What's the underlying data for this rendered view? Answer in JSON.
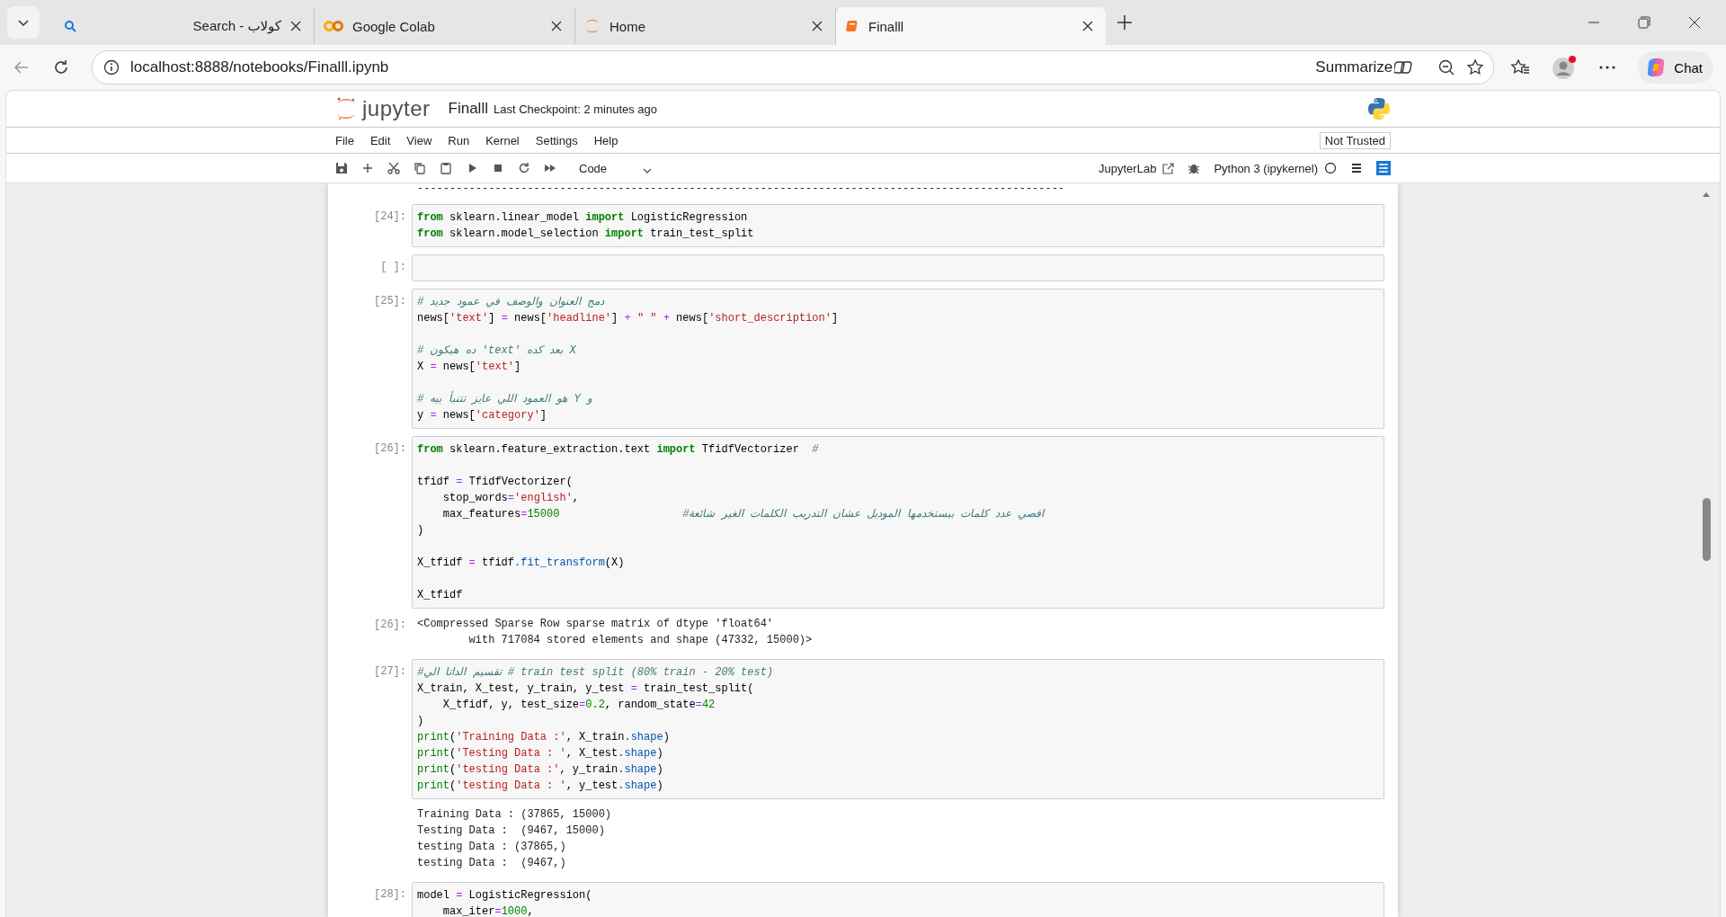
{
  "browser": {
    "tabs": [
      {
        "kind": "search",
        "title": "Search - كولاب",
        "selected": false
      },
      {
        "kind": "colab",
        "title": "Google Colab",
        "selected": false
      },
      {
        "kind": "jupyter",
        "title": "Home",
        "selected": false
      },
      {
        "kind": "notebook",
        "title": "Finalll",
        "selected": true
      }
    ],
    "url": "localhost:8888/notebooks/Finalll.ipynb",
    "summarize": "Summarize",
    "chat": "Chat"
  },
  "jupyter": {
    "logo_text": "jupyter",
    "notebook_name": "Finalll",
    "checkpoint": "Last Checkpoint: 2 minutes ago",
    "menu": [
      "File",
      "Edit",
      "View",
      "Run",
      "Kernel",
      "Settings",
      "Help"
    ],
    "trust": "Not Trusted",
    "cell_type": "Code",
    "lab_link": "JupyterLab",
    "kernel": "Python 3 (ipykernel)"
  },
  "cells": [
    {
      "kind": "output",
      "lines": [
        "----------------------------------------------------------------------------------------------------"
      ]
    },
    {
      "kind": "code",
      "prompt": "[24]:",
      "lines": [
        {
          "tokens": [
            {
              "text": "from",
              "kind": "kw"
            },
            {
              "text": " sklearn.linear_model ",
              "kind": "p"
            },
            {
              "text": "import",
              "kind": "kw"
            },
            {
              "text": " LogisticRegression",
              "kind": "p"
            }
          ]
        },
        {
          "tokens": [
            {
              "text": "from",
              "kind": "kw"
            },
            {
              "text": " sklearn.model_selection ",
              "kind": "p"
            },
            {
              "text": "import",
              "kind": "kw"
            },
            {
              "text": " train_test_split",
              "kind": "p"
            }
          ]
        }
      ]
    },
    {
      "kind": "code",
      "prompt": "[ ]:"
    },
    {
      "kind": "code",
      "prompt": "[25]:",
      "lines": [
        {
          "tokens": [
            {
              "text": "# دمج العنوان والوصف في عمود جديد",
              "kind": "com"
            }
          ]
        },
        {
          "tokens": [
            {
              "text": "news[",
              "kind": "p"
            },
            {
              "text": "'text'",
              "kind": "str"
            },
            {
              "text": "] ",
              "kind": "p"
            },
            {
              "text": "=",
              "kind": "op"
            },
            {
              "text": " news[",
              "kind": "p"
            },
            {
              "text": "'headline'",
              "kind": "str"
            },
            {
              "text": "] ",
              "kind": "p"
            },
            {
              "text": "+",
              "kind": "op"
            },
            {
              "text": " \" \" ",
              "kind": "str"
            },
            {
              "text": "+",
              "kind": "op"
            },
            {
              "text": " news[",
              "kind": "p"
            },
            {
              "text": "'short_description'",
              "kind": "str"
            },
            {
              "text": "]",
              "kind": "p"
            }
          ]
        },
        {
          "kind": "blank"
        },
        {
          "kind": "code",
          "tokens": [
            {
              "text": "# ده هيكون 'text' بعد كده X",
              "kind": "com"
            }
          ]
        },
        {
          "tokens": [
            {
              "text": "X ",
              "kind": "p"
            },
            {
              "text": "=",
              "kind": "op"
            },
            {
              "text": " news[",
              "kind": "p"
            },
            {
              "text": "'text'",
              "kind": "str"
            },
            {
              "text": "]",
              "kind": "p"
            }
          ]
        },
        {
          "kind": "blank"
        },
        {
          "kind": "code",
          "tokens": [
            {
              "text": "# هو العمود اللي عايز تتنبأ بيه Y و",
              "kind": "com"
            }
          ]
        },
        {
          "tokens": [
            {
              "text": "y ",
              "kind": "p"
            },
            {
              "text": "=",
              "kind": "op"
            },
            {
              "text": " news[",
              "kind": "p"
            },
            {
              "text": "'category'",
              "kind": "str"
            },
            {
              "text": "]",
              "kind": "p"
            }
          ]
        }
      ]
    },
    {
      "kind": "code",
      "prompt": "[26]:",
      "lines": [
        {
          "tokens": [
            {
              "text": "from",
              "kind": "kw"
            },
            {
              "text": " sklearn.feature_extraction.text ",
              "kind": "p"
            },
            {
              "text": "import",
              "kind": "kw"
            },
            {
              "text": " TfidfVectorizer  ",
              "kind": "p"
            },
            {
              "text": "#",
              "kind": "com"
            }
          ]
        },
        {
          "kind": "blank"
        },
        {
          "kind": "code",
          "tokens": [
            {
              "text": "tfidf ",
              "kind": "p"
            },
            {
              "text": "=",
              "kind": "op"
            },
            {
              "text": " TfidfVectorizer(",
              "kind": "p"
            }
          ]
        },
        {
          "tokens": [
            {
              "text": "    stop_words",
              "kind": "p"
            },
            {
              "text": "=",
              "kind": "op"
            },
            {
              "text": "'english'",
              "kind": "str"
            },
            {
              "text": ",",
              "kind": "p"
            }
          ]
        },
        {
          "tokens": [
            {
              "text": "    max_features",
              "kind": "p"
            },
            {
              "text": "=",
              "kind": "op"
            },
            {
              "text": "15000",
              "kind": "num"
            },
            {
              "text": "                   #اقصي عدد كلمات بيستخدمها الموديل عشان التدريب الكلمات الغير شائعة",
              "kind": "com"
            }
          ]
        },
        {
          "tokens": [
            {
              "text": ")",
              "kind": "p"
            }
          ]
        },
        {
          "kind": "blank"
        },
        {
          "kind": "code",
          "tokens": [
            {
              "text": "X_tfidf ",
              "kind": "p"
            },
            {
              "text": "=",
              "kind": "op"
            },
            {
              "text": " tfidf",
              "kind": "p"
            },
            {
              "text": ".fit_transform",
              "kind": "attr"
            },
            {
              "text": "(X)",
              "kind": "p"
            }
          ]
        },
        {
          "kind": "blank"
        },
        {
          "kind": "code",
          "tokens": [
            {
              "text": "X_tfidf",
              "kind": "p"
            }
          ]
        }
      ]
    },
    {
      "kind": "output",
      "prompt": "[26]:",
      "lines": [
        "<Compressed Sparse Row sparse matrix of dtype 'float64'",
        "        with 717084 stored elements and shape (47332, 15000)>"
      ]
    },
    {
      "kind": "code",
      "prompt": "[27]:",
      "lines": [
        {
          "tokens": [
            {
              "text": "#تقسيم الداتا الي # train test split (80% train - 20% test)",
              "kind": "com"
            }
          ]
        },
        {
          "tokens": [
            {
              "text": "X_train, X_test, y_train, y_test ",
              "kind": "p"
            },
            {
              "text": "=",
              "kind": "op"
            },
            {
              "text": " train_test_split(",
              "kind": "p"
            }
          ]
        },
        {
          "tokens": [
            {
              "text": "    X_tfidf, y, test_size",
              "kind": "p"
            },
            {
              "text": "=",
              "kind": "op"
            },
            {
              "text": "0.2",
              "kind": "num"
            },
            {
              "text": ", random_state",
              "kind": "p"
            },
            {
              "text": "=",
              "kind": "op"
            },
            {
              "text": "42",
              "kind": "num"
            }
          ]
        },
        {
          "tokens": [
            {
              "text": ")",
              "kind": "p"
            }
          ]
        },
        {
          "tokens": [
            {
              "text": "print",
              "kind": "fn"
            },
            {
              "text": "(",
              "kind": "p"
            },
            {
              "text": "'Training Data :'",
              "kind": "str"
            },
            {
              "text": ", X_train",
              "kind": "p"
            },
            {
              "text": ".shape",
              "kind": "attr"
            },
            {
              "text": ")",
              "kind": "p"
            }
          ]
        },
        {
          "tokens": [
            {
              "text": "print",
              "kind": "fn"
            },
            {
              "text": "(",
              "kind": "p"
            },
            {
              "text": "'Testing Data : '",
              "kind": "str"
            },
            {
              "text": ", X_test",
              "kind": "p"
            },
            {
              "text": ".shape",
              "kind": "attr"
            },
            {
              "text": ")",
              "kind": "p"
            }
          ]
        },
        {
          "tokens": [
            {
              "text": "print",
              "kind": "fn"
            },
            {
              "text": "(",
              "kind": "p"
            },
            {
              "text": "'testing Data :'",
              "kind": "str"
            },
            {
              "text": ", y_train",
              "kind": "p"
            },
            {
              "text": ".shape",
              "kind": "attr"
            },
            {
              "text": ")",
              "kind": "p"
            }
          ]
        },
        {
          "tokens": [
            {
              "text": "print",
              "kind": "fn"
            },
            {
              "text": "(",
              "kind": "p"
            },
            {
              "text": "'testing Data : '",
              "kind": "str"
            },
            {
              "text": ", y_test",
              "kind": "p"
            },
            {
              "text": ".shape",
              "kind": "attr"
            },
            {
              "text": ")",
              "kind": "p"
            }
          ]
        }
      ]
    },
    {
      "kind": "output",
      "lines": [
        "Training Data : (37865, 15000)",
        "Testing Data :  (9467, 15000)",
        "testing Data : (37865,)",
        "testing Data :  (9467,)"
      ]
    },
    {
      "kind": "code",
      "prompt": "[28]:",
      "lines": [
        {
          "tokens": [
            {
              "text": "model ",
              "kind": "p"
            },
            {
              "text": "=",
              "kind": "op"
            },
            {
              "text": " LogisticRegression(",
              "kind": "p"
            }
          ]
        },
        {
          "tokens": [
            {
              "text": "    max_iter",
              "kind": "p"
            },
            {
              "text": "=",
              "kind": "op"
            },
            {
              "text": "1000",
              "kind": "num"
            },
            {
              "text": ",",
              "kind": "p"
            }
          ]
        }
      ]
    }
  ]
}
